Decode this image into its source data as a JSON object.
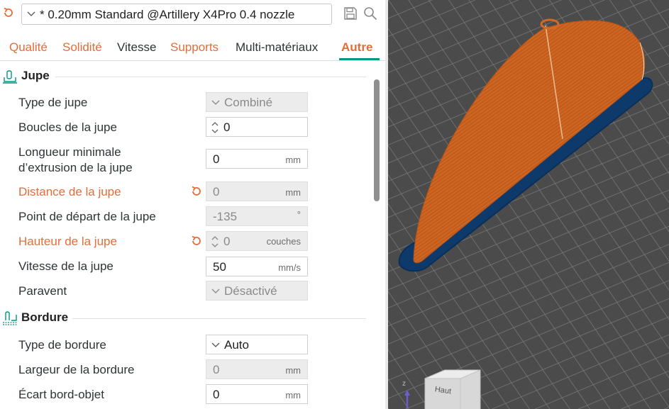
{
  "preset": {
    "name": "* 0.20mm Standard @Artillery X4Pro 0.4 nozzle"
  },
  "tabs": [
    {
      "label": "Qualité",
      "state": "modified"
    },
    {
      "label": "Solidité",
      "state": "modified"
    },
    {
      "label": "Vitesse",
      "state": "normal"
    },
    {
      "label": "Supports",
      "state": "modified"
    },
    {
      "label": "Multi-matériaux",
      "state": "normal"
    },
    {
      "label": "Autre",
      "state": "active"
    }
  ],
  "sections": {
    "skirt": {
      "title": "Jupe",
      "rows": [
        {
          "label": "Type de jupe",
          "value": "Combiné",
          "unit": ""
        },
        {
          "label": "Boucles de la jupe",
          "value": "0",
          "unit": ""
        },
        {
          "label": "Longueur minimale",
          "label2": "d’extrusion de la jupe",
          "value": "0",
          "unit": "mm"
        },
        {
          "label": "Distance de la jupe",
          "value": "0",
          "unit": "mm"
        },
        {
          "label": "Point de départ de la jupe",
          "value": "-135",
          "unit": "°"
        },
        {
          "label": "Hauteur de la jupe",
          "value": "0",
          "unit": "couches"
        },
        {
          "label": "Vitesse de la jupe",
          "value": "50",
          "unit": "mm/s"
        },
        {
          "label": "Paravent",
          "value": "Désactivé",
          "unit": ""
        }
      ]
    },
    "brim": {
      "title": "Bordure",
      "rows": [
        {
          "label": "Type de bordure",
          "value": "Auto",
          "unit": ""
        },
        {
          "label": "Largeur de la bordure",
          "value": "0",
          "unit": "mm"
        },
        {
          "label": "Écart bord-objet",
          "value": "0",
          "unit": "mm"
        }
      ]
    }
  },
  "viewport": {
    "cube_label": "Haut",
    "axis_z": "z"
  },
  "colors": {
    "accent": "#e56c38",
    "tab_active_underline": "#009688",
    "model": "#c8601f",
    "brim": "#0d3a6b",
    "bed": "#4a4a4a"
  },
  "icons": [
    "undo-icon",
    "chevron-down-icon",
    "save-icon",
    "search-icon",
    "skirt-section-icon",
    "brim-section-icon",
    "spin-icon"
  ]
}
